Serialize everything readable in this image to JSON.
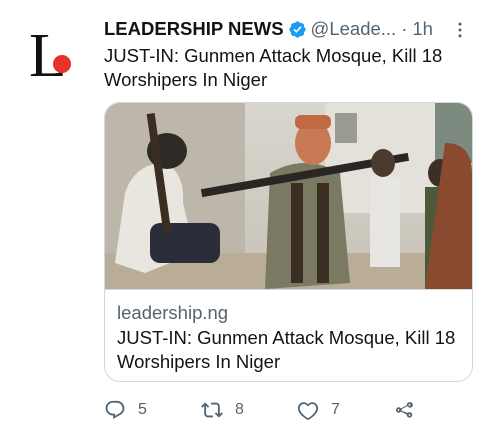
{
  "account": {
    "name": "LEADERSHIP NEWS",
    "handle": "@Leade...",
    "separator": "·",
    "time": "1h",
    "avatar_letter": "L"
  },
  "tweet": {
    "text": "JUST-IN: Gunmen Attack Mosque, Kill 18 Worshipers In Niger"
  },
  "card": {
    "domain": "leadership.ng",
    "title": "JUST-IN: Gunmen Attack Mosque, Kill 18 Worshipers In Niger"
  },
  "actions": {
    "replies": "5",
    "retweets": "8",
    "likes": "7"
  },
  "colors": {
    "text": "#0f1419",
    "secondary": "#536471",
    "verified": "#1d9bf0",
    "border": "#cfd9de",
    "logo_red": "#e5332a"
  },
  "icons": [
    "more-icon",
    "verified-badge-icon",
    "reply-icon",
    "retweet-icon",
    "like-icon",
    "share-icon"
  ]
}
